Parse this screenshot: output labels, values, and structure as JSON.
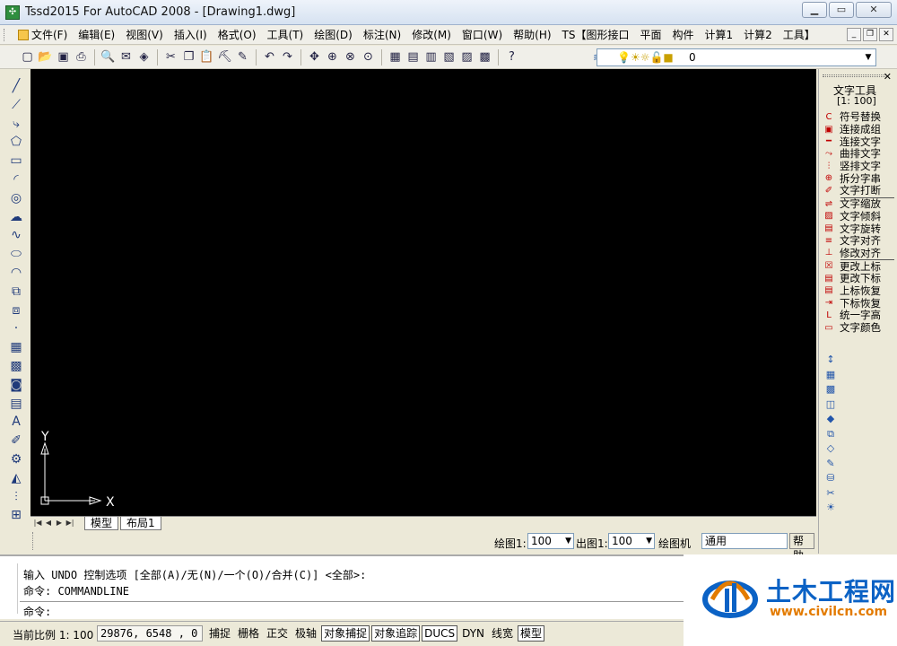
{
  "window": {
    "title": "Tssd2015 For AutoCAD 2008 - [Drawing1.dwg]",
    "icon": "app-icon"
  },
  "menubar": {
    "items": [
      "文件(F)",
      "编辑(E)",
      "视图(V)",
      "插入(I)",
      "格式(O)",
      "工具(T)",
      "绘图(D)",
      "标注(N)",
      "修改(M)",
      "窗口(W)",
      "帮助(H)",
      "TS【图形接口",
      "平面",
      "构件",
      "计算1",
      "计算2",
      "工具】"
    ]
  },
  "toolbar": {
    "icons": [
      "new-icon",
      "open-icon",
      "save-icon",
      "print-icon",
      "preview-icon",
      "publish-icon",
      "3d-icon",
      "cut-icon",
      "copy-icon",
      "paste-icon",
      "matchprop-icon",
      "brush-icon",
      "undo-icon",
      "redo-icon",
      "pan-icon",
      "zoom-realtime-icon",
      "zoom-window-icon",
      "zoom-previous-icon",
      "properties-icon",
      "designcenter-icon",
      "toolpalette-icon",
      "sheetset-icon",
      "markup-icon",
      "calculator-icon",
      "help-icon"
    ],
    "layer_value": "0"
  },
  "left_toolbar": {
    "icons": [
      "line-icon",
      "xline-icon",
      "polyline-icon",
      "polygon-icon",
      "rectangle-icon",
      "arc-icon",
      "circle-icon",
      "revcloud-icon",
      "spline-icon",
      "ellipse-icon",
      "ellipse-arc-icon",
      "insert-block-icon",
      "make-block-icon",
      "point-icon",
      "hatch-icon",
      "gradient-icon",
      "region-icon",
      "table-icon",
      "text-icon",
      "pen-icon",
      "wipeout-icon",
      "mirror-icon",
      "offset-icon",
      "array-icon"
    ]
  },
  "ucs": {
    "y_label": "Y",
    "x_label": "X"
  },
  "tabs": {
    "model": "模型",
    "layout1": "布局1"
  },
  "scale_bar": {
    "draw_scale_label": "绘图1:",
    "draw_scale_value": "100",
    "output_scale_label": "出图1:",
    "output_scale_value": "100",
    "extra_label": "绘图机",
    "extra_value": "通用",
    "help_label": "帮助"
  },
  "right_panel": {
    "title": "文字工具",
    "scale": "[1: 100]",
    "groups": [
      [
        "符号替换",
        "连接成组",
        "连接文字",
        "曲排文字",
        "竖排文字",
        "拆分字串",
        "文字打断"
      ],
      [
        "文字缩放",
        "文字倾斜",
        "文字旋转",
        "文字对齐",
        "修改对齐"
      ],
      [
        "更改上标",
        "更改下标",
        "上标恢复",
        "下标恢复",
        "统一字高",
        "文字颜色"
      ]
    ],
    "extra_icon_count": 11
  },
  "command": {
    "line1": "输入 UNDO 控制选项 [全部(A)/无(N)/一个(O)/合并(C)] <全部>:",
    "line2": "命令: COMMANDLINE",
    "prompt": "命令:"
  },
  "statusbar": {
    "scale_label": "当前比例 1: 100",
    "coords": "29876, 6548 , 0",
    "toggles": [
      {
        "label": "捕捉",
        "on": false
      },
      {
        "label": "栅格",
        "on": false
      },
      {
        "label": "正交",
        "on": false
      },
      {
        "label": "极轴",
        "on": false
      },
      {
        "label": "对象捕捉",
        "on": true
      },
      {
        "label": "对象追踪",
        "on": true
      },
      {
        "label": "DUCS",
        "on": true
      },
      {
        "label": "DYN",
        "on": false
      },
      {
        "label": "线宽",
        "on": false
      },
      {
        "label": "模型",
        "on": true
      }
    ]
  },
  "watermark": {
    "title": "土木工程网",
    "url": "www.civilcn.com"
  }
}
